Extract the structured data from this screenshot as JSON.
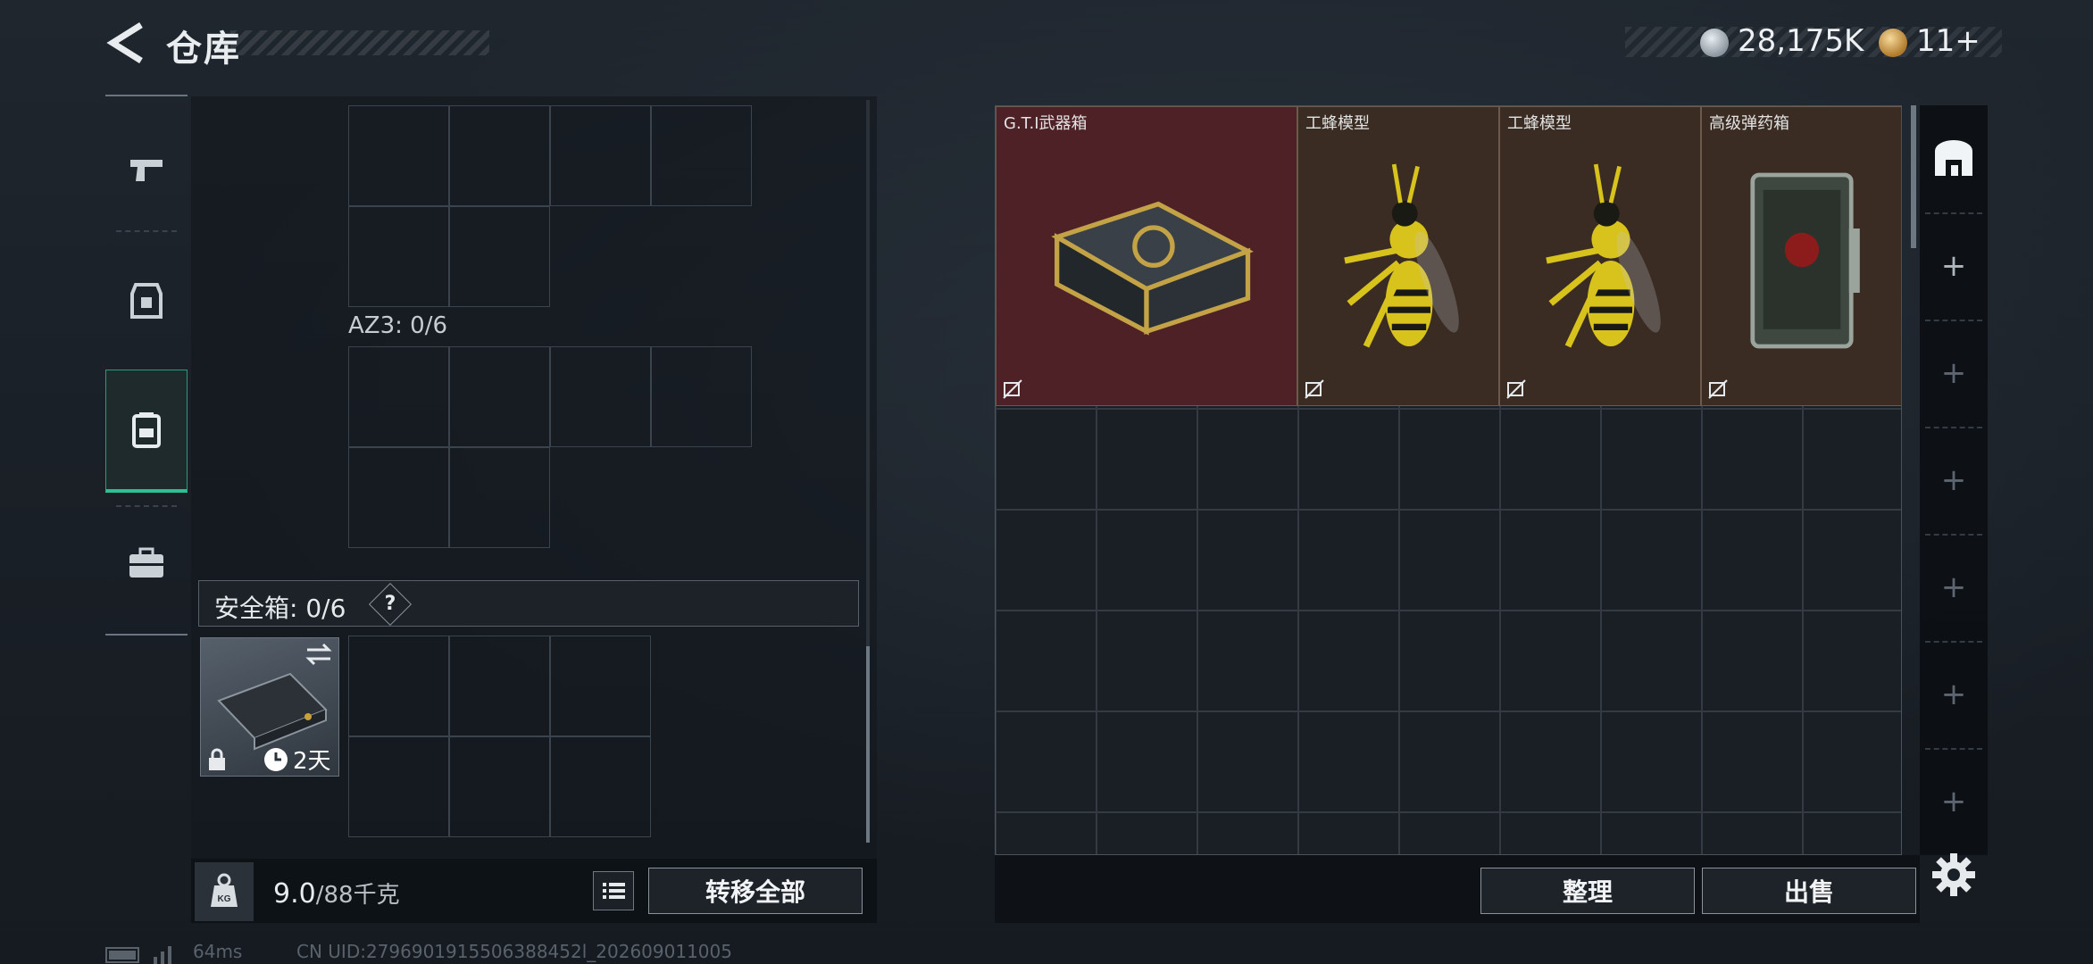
{
  "header": {
    "title": "仓库",
    "currency_silver": "28,175K",
    "currency_gold": "11+"
  },
  "colors": {
    "accent_green": "#2fbf92",
    "red_item_bg": "#4e2127",
    "brown_item_bg": "#3a2c23"
  },
  "sidebar": {
    "tabs": [
      {
        "name": "weapons",
        "icon": "pistol-icon"
      },
      {
        "name": "armor",
        "icon": "armor-icon"
      },
      {
        "name": "backpack",
        "icon": "backpack-icon",
        "active": true
      },
      {
        "name": "case",
        "icon": "briefcase-icon"
      }
    ]
  },
  "left_panel": {
    "az3_label": "AZ3: 0/6",
    "safe_box_label": "安全箱: 0/6",
    "help": "?",
    "safe_item_time": "2天",
    "weight_value": "9.0",
    "weight_max": "/88千克",
    "transfer_all": "转移全部"
  },
  "storage": {
    "items": [
      {
        "name": "G.T.I武器箱",
        "color": "#4e2127",
        "width_cells": 2,
        "icon": "weapon-crate-icon"
      },
      {
        "name": "工蜂模型",
        "color": "#3a2c23",
        "width_cells": 1,
        "icon": "wasp-model-icon"
      },
      {
        "name": "工蜂模型",
        "color": "#3a2c23",
        "width_cells": 1,
        "icon": "wasp-model-icon"
      },
      {
        "name": "高级弹药箱",
        "color": "#3a2c23",
        "width_cells": 1,
        "icon": "ammo-box-icon"
      }
    ],
    "sort": "整理",
    "sell": "出售"
  },
  "footer": {
    "ping": "64ms",
    "uid": "CN UID:2796901915506388452l_202609011005"
  }
}
